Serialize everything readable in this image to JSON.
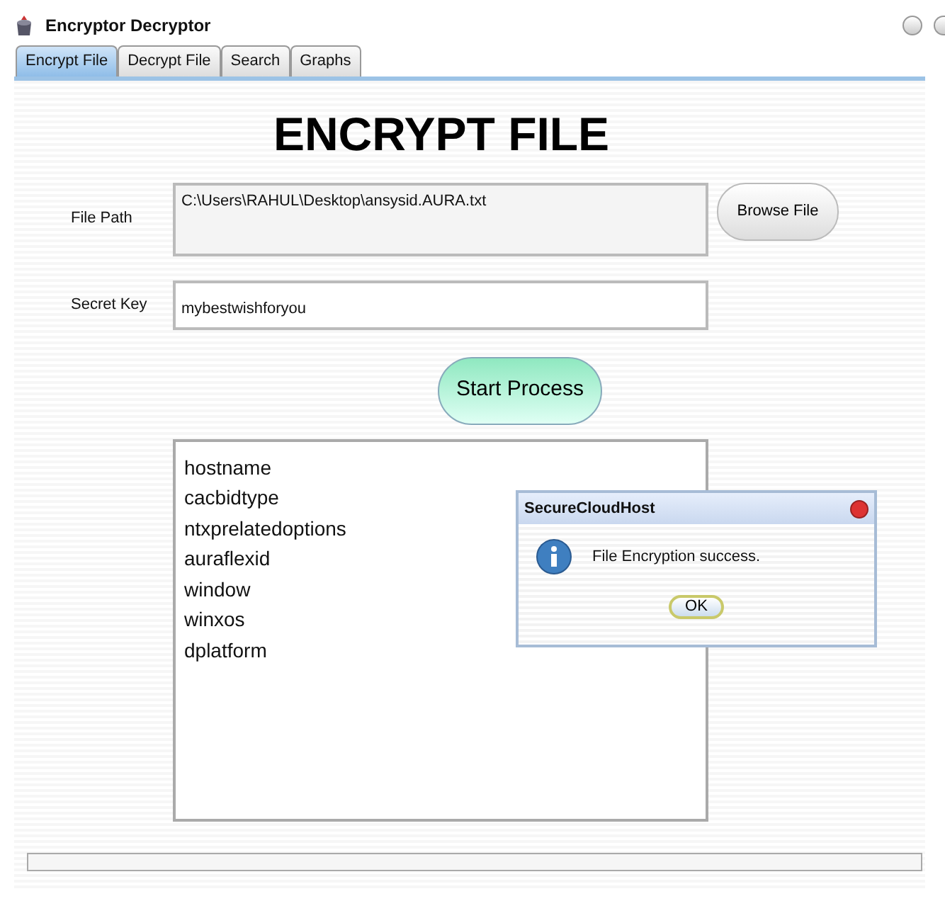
{
  "window": {
    "title": "Encryptor Decryptor"
  },
  "tabs": [
    {
      "label": "Encrypt File",
      "selected": true
    },
    {
      "label": "Decrypt File",
      "selected": false
    },
    {
      "label": "Search",
      "selected": false
    },
    {
      "label": "Graphs",
      "selected": false
    }
  ],
  "heading": "ENCRYPT FILE",
  "file_path": {
    "label": "File Path",
    "value": "C:\\Users\\RAHUL\\Desktop\\ansysid.AURA.txt"
  },
  "browse_button": "Browse File",
  "secret_key": {
    "label": "Secret Key",
    "value": "mybestwishforyou"
  },
  "start_button": "Start Process",
  "output_lines": [
    "hostname",
    "cacbidtype",
    "ntxprelatedoptions",
    "auraflexid",
    "window",
    "winxos",
    "dplatform"
  ],
  "dialog": {
    "title": "SecureCloudHost",
    "message": "File Encryption success.",
    "button": "OK"
  }
}
